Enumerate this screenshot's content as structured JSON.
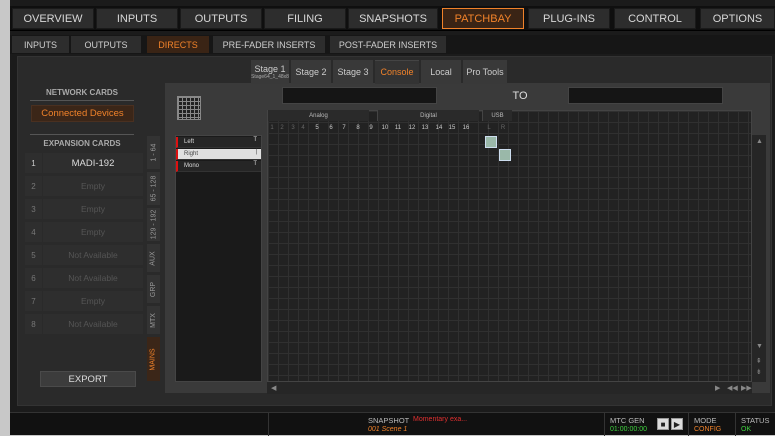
{
  "top_nav": [
    "OVERVIEW",
    "INPUTS",
    "OUTPUTS",
    "FILING",
    "SNAPSHOTS",
    "PATCHBAY",
    "PLUG-INS",
    "CONTROL",
    "OPTIONS"
  ],
  "sub_nav": [
    "INPUTS",
    "OUTPUTS",
    "DIRECTS",
    "PRE-FADER INSERTS",
    "POST-FADER INSERTS"
  ],
  "network": {
    "header": "NETWORK CARDS",
    "button": "Connected Devices"
  },
  "expansion": {
    "header": "EXPANSION CARDS",
    "cards": [
      {
        "num": "1",
        "label": "MADI-192"
      },
      {
        "num": "2",
        "label": "Empty"
      },
      {
        "num": "3",
        "label": "Empty"
      },
      {
        "num": "4",
        "label": "Empty"
      },
      {
        "num": "5",
        "label": "Not Available"
      },
      {
        "num": "6",
        "label": "Not Available"
      },
      {
        "num": "7",
        "label": "Empty"
      },
      {
        "num": "8",
        "label": "Not Available"
      }
    ]
  },
  "vtabs": [
    "1 - 64",
    "65 - 128",
    "129 - 192",
    "AUX",
    "GRP",
    "MTX",
    "MAINS"
  ],
  "export": "EXPORT",
  "stage_tabs": [
    {
      "label": "Stage 1",
      "sub": "Stage64_1_48x8"
    },
    {
      "label": "Stage 2",
      "sub": ""
    },
    {
      "label": "Stage 3",
      "sub": ""
    },
    {
      "label": "Console",
      "sub": ""
    },
    {
      "label": "Local",
      "sub": ""
    },
    {
      "label": "Pro Tools",
      "sub": ""
    }
  ],
  "to_label": "TO",
  "groups": [
    "Analog",
    "Digital",
    "USB"
  ],
  "columns": [
    "1",
    "2",
    "3",
    "4",
    "5",
    "6",
    "7",
    "8",
    "9",
    "10",
    "11",
    "12",
    "13",
    "14",
    "15",
    "16",
    "L",
    "R"
  ],
  "sources": [
    {
      "name": "Left",
      "end": "T"
    },
    {
      "name": "Right",
      "end": "|"
    },
    {
      "name": "Mono",
      "end": "T"
    }
  ],
  "status": {
    "snapshot_label": "SNAPSHOT",
    "snapshot_msg": "Momentary exa...",
    "snapshot_scene": "001 Scene 1",
    "mtc_label": "MTC GEN",
    "mtc_time": "01:00:00:00",
    "mode_label": "MODE",
    "mode_value": "CONFIG",
    "status_label": "STATUS",
    "status_value": "OK"
  },
  "colors": {
    "accent": "#f0822a",
    "ok": "#3fd23f",
    "alert": "#e03030"
  }
}
